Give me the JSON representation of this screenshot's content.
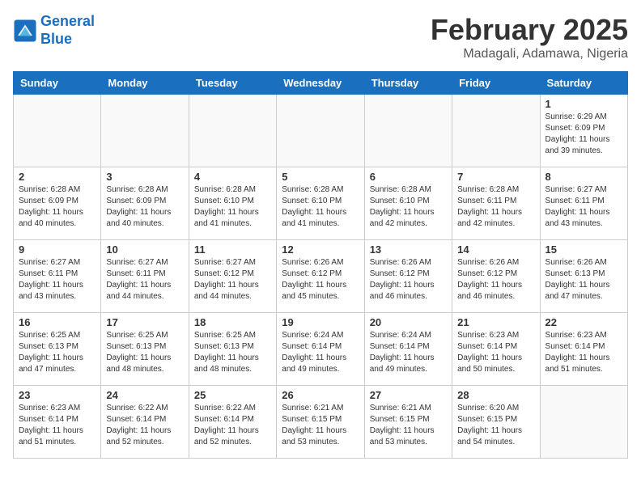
{
  "header": {
    "logo_line1": "General",
    "logo_line2": "Blue",
    "title": "February 2025",
    "subtitle": "Madagali, Adamawa, Nigeria"
  },
  "weekdays": [
    "Sunday",
    "Monday",
    "Tuesday",
    "Wednesday",
    "Thursday",
    "Friday",
    "Saturday"
  ],
  "weeks": [
    [
      {
        "day": "",
        "info": ""
      },
      {
        "day": "",
        "info": ""
      },
      {
        "day": "",
        "info": ""
      },
      {
        "day": "",
        "info": ""
      },
      {
        "day": "",
        "info": ""
      },
      {
        "day": "",
        "info": ""
      },
      {
        "day": "1",
        "info": "Sunrise: 6:29 AM\nSunset: 6:09 PM\nDaylight: 11 hours\nand 39 minutes."
      }
    ],
    [
      {
        "day": "2",
        "info": "Sunrise: 6:28 AM\nSunset: 6:09 PM\nDaylight: 11 hours\nand 40 minutes."
      },
      {
        "day": "3",
        "info": "Sunrise: 6:28 AM\nSunset: 6:09 PM\nDaylight: 11 hours\nand 40 minutes."
      },
      {
        "day": "4",
        "info": "Sunrise: 6:28 AM\nSunset: 6:10 PM\nDaylight: 11 hours\nand 41 minutes."
      },
      {
        "day": "5",
        "info": "Sunrise: 6:28 AM\nSunset: 6:10 PM\nDaylight: 11 hours\nand 41 minutes."
      },
      {
        "day": "6",
        "info": "Sunrise: 6:28 AM\nSunset: 6:10 PM\nDaylight: 11 hours\nand 42 minutes."
      },
      {
        "day": "7",
        "info": "Sunrise: 6:28 AM\nSunset: 6:11 PM\nDaylight: 11 hours\nand 42 minutes."
      },
      {
        "day": "8",
        "info": "Sunrise: 6:27 AM\nSunset: 6:11 PM\nDaylight: 11 hours\nand 43 minutes."
      }
    ],
    [
      {
        "day": "9",
        "info": "Sunrise: 6:27 AM\nSunset: 6:11 PM\nDaylight: 11 hours\nand 43 minutes."
      },
      {
        "day": "10",
        "info": "Sunrise: 6:27 AM\nSunset: 6:11 PM\nDaylight: 11 hours\nand 44 minutes."
      },
      {
        "day": "11",
        "info": "Sunrise: 6:27 AM\nSunset: 6:12 PM\nDaylight: 11 hours\nand 44 minutes."
      },
      {
        "day": "12",
        "info": "Sunrise: 6:26 AM\nSunset: 6:12 PM\nDaylight: 11 hours\nand 45 minutes."
      },
      {
        "day": "13",
        "info": "Sunrise: 6:26 AM\nSunset: 6:12 PM\nDaylight: 11 hours\nand 46 minutes."
      },
      {
        "day": "14",
        "info": "Sunrise: 6:26 AM\nSunset: 6:12 PM\nDaylight: 11 hours\nand 46 minutes."
      },
      {
        "day": "15",
        "info": "Sunrise: 6:26 AM\nSunset: 6:13 PM\nDaylight: 11 hours\nand 47 minutes."
      }
    ],
    [
      {
        "day": "16",
        "info": "Sunrise: 6:25 AM\nSunset: 6:13 PM\nDaylight: 11 hours\nand 47 minutes."
      },
      {
        "day": "17",
        "info": "Sunrise: 6:25 AM\nSunset: 6:13 PM\nDaylight: 11 hours\nand 48 minutes."
      },
      {
        "day": "18",
        "info": "Sunrise: 6:25 AM\nSunset: 6:13 PM\nDaylight: 11 hours\nand 48 minutes."
      },
      {
        "day": "19",
        "info": "Sunrise: 6:24 AM\nSunset: 6:14 PM\nDaylight: 11 hours\nand 49 minutes."
      },
      {
        "day": "20",
        "info": "Sunrise: 6:24 AM\nSunset: 6:14 PM\nDaylight: 11 hours\nand 49 minutes."
      },
      {
        "day": "21",
        "info": "Sunrise: 6:23 AM\nSunset: 6:14 PM\nDaylight: 11 hours\nand 50 minutes."
      },
      {
        "day": "22",
        "info": "Sunrise: 6:23 AM\nSunset: 6:14 PM\nDaylight: 11 hours\nand 51 minutes."
      }
    ],
    [
      {
        "day": "23",
        "info": "Sunrise: 6:23 AM\nSunset: 6:14 PM\nDaylight: 11 hours\nand 51 minutes."
      },
      {
        "day": "24",
        "info": "Sunrise: 6:22 AM\nSunset: 6:14 PM\nDaylight: 11 hours\nand 52 minutes."
      },
      {
        "day": "25",
        "info": "Sunrise: 6:22 AM\nSunset: 6:14 PM\nDaylight: 11 hours\nand 52 minutes."
      },
      {
        "day": "26",
        "info": "Sunrise: 6:21 AM\nSunset: 6:15 PM\nDaylight: 11 hours\nand 53 minutes."
      },
      {
        "day": "27",
        "info": "Sunrise: 6:21 AM\nSunset: 6:15 PM\nDaylight: 11 hours\nand 53 minutes."
      },
      {
        "day": "28",
        "info": "Sunrise: 6:20 AM\nSunset: 6:15 PM\nDaylight: 11 hours\nand 54 minutes."
      },
      {
        "day": "",
        "info": ""
      }
    ]
  ]
}
